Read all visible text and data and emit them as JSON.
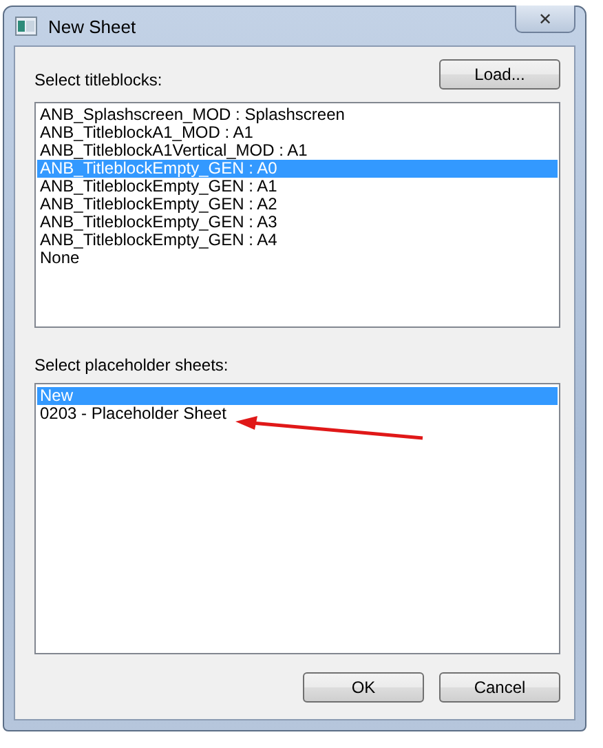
{
  "window": {
    "title": "New Sheet",
    "close": "✕"
  },
  "titleblocks": {
    "label": "Select titleblocks:",
    "load_button": "Load...",
    "items": [
      {
        "label": "ANB_Splashscreen_MOD : Splashscreen",
        "selected": false
      },
      {
        "label": "ANB_TitleblockA1_MOD : A1",
        "selected": false
      },
      {
        "label": "ANB_TitleblockA1Vertical_MOD : A1",
        "selected": false
      },
      {
        "label": "ANB_TitleblockEmpty_GEN : A0",
        "selected": true
      },
      {
        "label": "ANB_TitleblockEmpty_GEN : A1",
        "selected": false
      },
      {
        "label": "ANB_TitleblockEmpty_GEN : A2",
        "selected": false
      },
      {
        "label": "ANB_TitleblockEmpty_GEN : A3",
        "selected": false
      },
      {
        "label": "ANB_TitleblockEmpty_GEN : A4",
        "selected": false
      },
      {
        "label": "None",
        "selected": false
      }
    ]
  },
  "placeholders": {
    "label": "Select placeholder sheets:",
    "items": [
      {
        "label": "New",
        "selected": true
      },
      {
        "label": "0203 - Placeholder Sheet",
        "selected": false
      }
    ]
  },
  "buttons": [
    "OK",
    "Cancel"
  ]
}
